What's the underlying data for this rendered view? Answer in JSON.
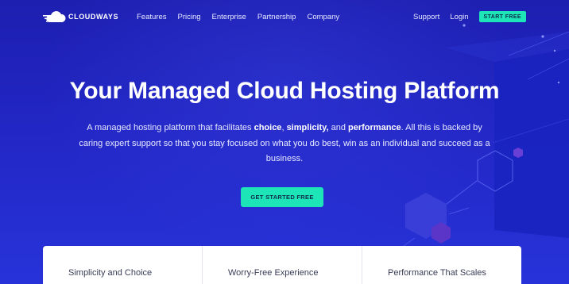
{
  "brand": {
    "name": "CLOUDWAYS"
  },
  "nav": {
    "links": [
      "Features",
      "Pricing",
      "Enterprise",
      "Partnership",
      "Company"
    ],
    "support": "Support",
    "login": "Login",
    "start_free": "START FREE"
  },
  "hero": {
    "title": "Your Managed Cloud Hosting Platform",
    "desc_1": "A managed hosting platform that facilitates ",
    "choice": "choice",
    "sep_1": ", ",
    "simplicity": "simplicity,",
    "and": " and ",
    "performance": "performance",
    "desc_2": ". All this is backed by caring expert support so that you stay focused on what you do best, win as an individual and succeed as a business.",
    "cta": "GET STARTED FREE"
  },
  "features": [
    "Simplicity and Choice",
    "Worry-Free Experience",
    "Performance That Scales"
  ],
  "colors": {
    "accent": "#1ee5b8",
    "background": "#2226c4"
  },
  "icons": {
    "logo": "cloud-icon"
  }
}
